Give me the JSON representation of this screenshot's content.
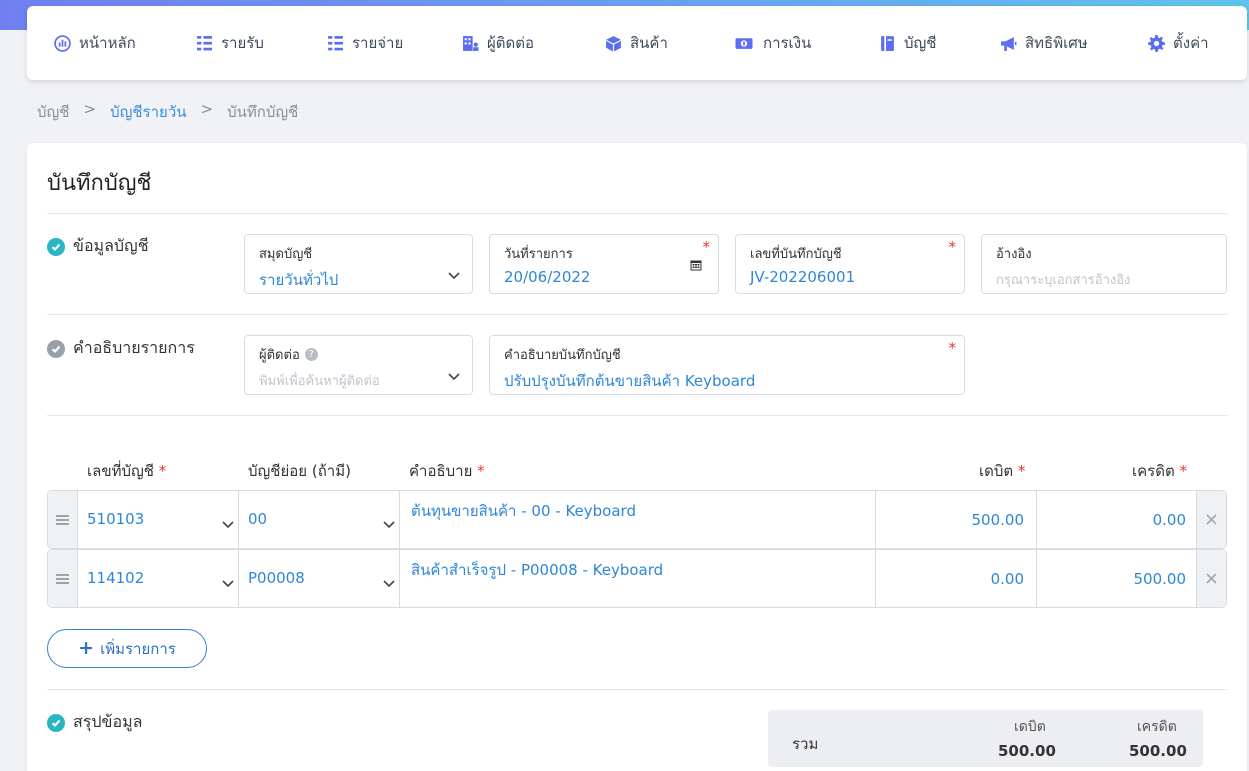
{
  "nav": {
    "items": [
      {
        "label": "หน้าหลัก",
        "icon": "dashboard-icon"
      },
      {
        "label": "รายรับ",
        "icon": "income-list-icon"
      },
      {
        "label": "รายจ่าย",
        "icon": "expense-list-icon"
      },
      {
        "label": "ผู้ติดต่อ",
        "icon": "contacts-icon"
      },
      {
        "label": "สินค้า",
        "icon": "product-box-icon"
      },
      {
        "label": "การเงิน",
        "icon": "money-icon"
      },
      {
        "label": "บัญชี",
        "icon": "ledger-book-icon"
      },
      {
        "label": "สิทธิพิเศษ",
        "icon": "megaphone-icon"
      },
      {
        "label": "ตั้งค่า",
        "icon": "gear-icon"
      }
    ]
  },
  "breadcrumb": {
    "level1": "บัญชี",
    "level2": "บัญชีรายวัน",
    "level3": "บันทึกบัญชี",
    "separator": ">"
  },
  "page": {
    "title": "บันทึกบัญชี"
  },
  "account_info": {
    "section_title": "ข้อมูลบัญชี",
    "journal": {
      "label": "สมุดบัญชี",
      "value": "รายวันทั่วไป"
    },
    "date": {
      "label": "วันที่รายการ",
      "value": "20/06/2022",
      "required": "*"
    },
    "doc_no": {
      "label": "เลขที่บันทึกบัญชี",
      "value": "JV-202206001",
      "required": "*"
    },
    "reference": {
      "label": "อ้างอิง",
      "placeholder": "กรุณาระบุเอกสารอ้างอิง"
    }
  },
  "description_section": {
    "section_title": "คำอธิบายรายการ",
    "contact": {
      "label": "ผู้ติดต่อ",
      "help": "?",
      "placeholder": "พิมพ์เพื่อค้นหาผู้ติดต่อ"
    },
    "memo": {
      "label": "คำอธิบายบันทึกบัญชี",
      "value": "ปรับปรุงบันทึกต้นขายสินค้า Keyboard",
      "required": "*"
    }
  },
  "table": {
    "headers": {
      "account": "เลขที่บัญชี",
      "sub_account": "บัญชีย่อย (ถ้ามี)",
      "description": "คำอธิบาย",
      "debit": "เดบิต",
      "credit": "เครดิต",
      "star": "*"
    },
    "rows": [
      {
        "account": "510103",
        "sub_account": "00",
        "description": "ต้นทุนขายสินค้า - 00 - Keyboard",
        "debit": "500.00",
        "credit": "0.00"
      },
      {
        "account": "114102",
        "sub_account": "P00008",
        "description": "สินค้าสำเร็จรูป - P00008 - Keyboard",
        "debit": "0.00",
        "credit": "500.00"
      }
    ]
  },
  "add_button": {
    "plus": "+",
    "label": "เพิ่มรายการ"
  },
  "summary": {
    "section_title": "สรุปข้อมูล",
    "total_label": "รวม",
    "debit_header": "เดบิต",
    "credit_header": "เครดิต",
    "debit_total": "500.00",
    "credit_total": "500.00"
  },
  "colors": {
    "accent": "#5b6ef0",
    "link": "#2f86d6",
    "required": "#e53935",
    "check_teal": "#2bb4c2"
  }
}
